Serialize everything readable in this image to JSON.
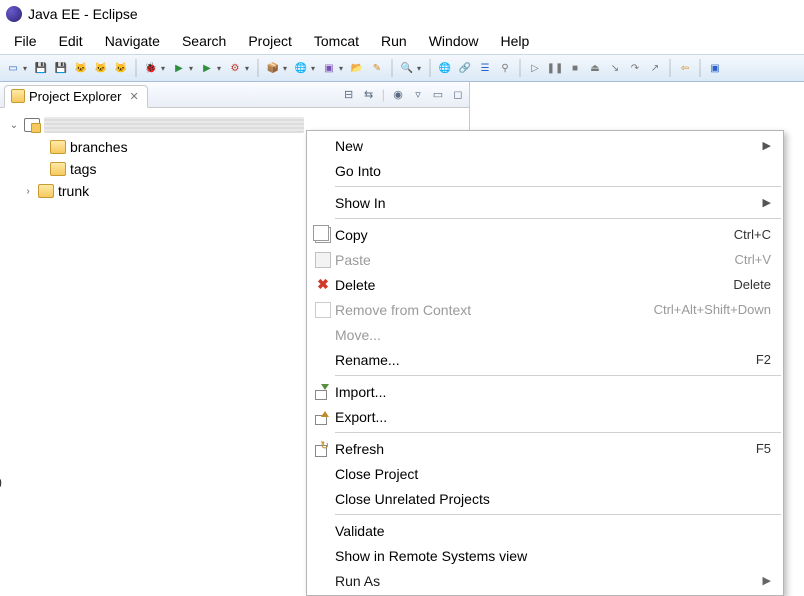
{
  "title": "Java EE - Eclipse",
  "menubar": [
    "File",
    "Edit",
    "Navigate",
    "Search",
    "Project",
    "Tomcat",
    "Run",
    "Window",
    "Help"
  ],
  "explorer": {
    "tab_label": "Project Explorer",
    "items": {
      "branches": "branches",
      "tags": "tags",
      "trunk": "trunk"
    }
  },
  "context_menu": {
    "new": "New",
    "go_into": "Go Into",
    "show_in": "Show In",
    "copy": {
      "label": "Copy",
      "accel": "Ctrl+C"
    },
    "paste": {
      "label": "Paste",
      "accel": "Ctrl+V"
    },
    "delete": {
      "label": "Delete",
      "accel": "Delete"
    },
    "remove_ctx": {
      "label": "Remove from Context",
      "accel": "Ctrl+Alt+Shift+Down"
    },
    "move": "Move...",
    "rename": {
      "label": "Rename...",
      "accel": "F2"
    },
    "import": "Import...",
    "export": "Export...",
    "refresh": {
      "label": "Refresh",
      "accel": "F5"
    },
    "close_project": "Close Project",
    "close_unrelated": "Close Unrelated Projects",
    "validate": "Validate",
    "show_remote": "Show in Remote Systems view",
    "run_as": "Run As"
  },
  "toolbar_icons": [
    "new",
    "save",
    "save-all",
    "tomcat-start",
    "tomcat-stop",
    "tomcat-restart",
    "debug",
    "run",
    "run-last",
    "external-tools",
    "build",
    "search",
    "tasks",
    "open-type",
    "open-resource",
    "annotations",
    "toggle-breadcrumb",
    "markers",
    "back",
    "forward",
    "web",
    "last-edit",
    "pin",
    "next",
    "previous",
    "step-over",
    "step-into",
    "step-return",
    "resume",
    "terminate",
    "drop-frame",
    "perspective"
  ]
}
